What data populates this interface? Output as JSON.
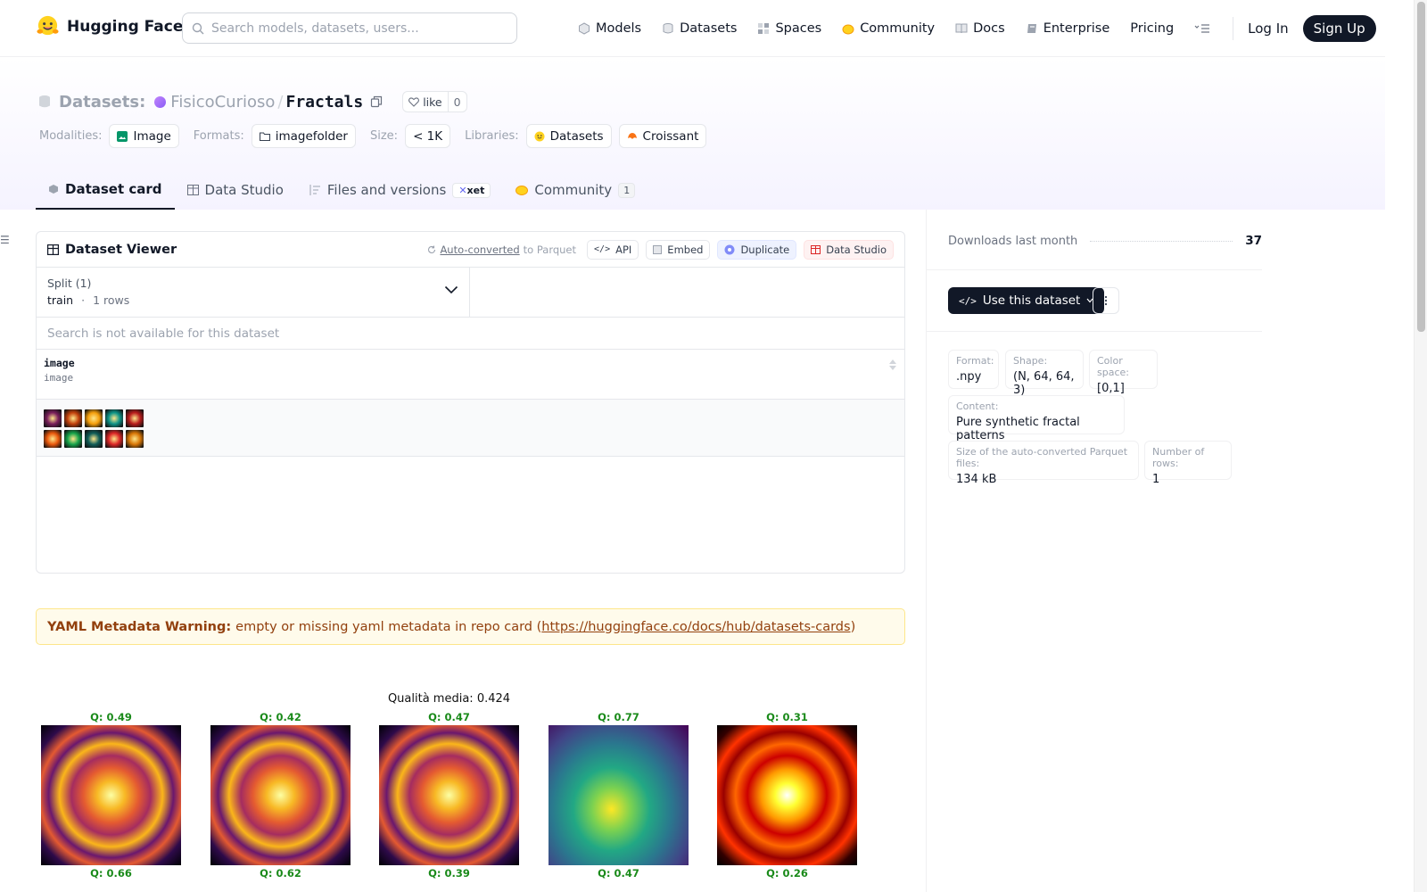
{
  "brand": {
    "name": "Hugging Face"
  },
  "search": {
    "placeholder": "Search models, datasets, users..."
  },
  "nav": {
    "items": [
      {
        "label": "Models",
        "icon": "models-icon"
      },
      {
        "label": "Datasets",
        "icon": "datasets-icon"
      },
      {
        "label": "Spaces",
        "icon": "spaces-icon"
      },
      {
        "label": "Community",
        "icon": "community-icon"
      },
      {
        "label": "Docs",
        "icon": "docs-icon"
      },
      {
        "label": "Enterprise",
        "icon": "enterprise-icon"
      },
      {
        "label": "Pricing"
      }
    ],
    "login": "Log In",
    "signup": "Sign Up"
  },
  "repo": {
    "type_label": "Datasets:",
    "org": "FisicoCurioso",
    "separator": "/",
    "name": "Fractals",
    "like_label": "like",
    "like_count": "0"
  },
  "tags": {
    "modalities_label": "Modalities:",
    "modality": "Image",
    "formats_label": "Formats:",
    "format": "imagefolder",
    "size_label": "Size:",
    "size": "< 1K",
    "libraries_label": "Libraries:",
    "libraries": [
      "Datasets",
      "Croissant"
    ]
  },
  "tabs": [
    {
      "label": "Dataset card",
      "active": true
    },
    {
      "label": "Data Studio"
    },
    {
      "label": "Files and versions",
      "badge": "xet"
    },
    {
      "label": "Community",
      "badge": "1"
    }
  ],
  "viewer": {
    "title": "Dataset Viewer",
    "auto_converted": "Auto-converted",
    "to_parquet": "to Parquet",
    "api": "API",
    "embed": "Embed",
    "duplicate": "Duplicate",
    "data_studio": "Data Studio",
    "split_label": "Split (1)",
    "split_name": "train",
    "split_dot": "·",
    "split_rows": "1 rows",
    "search_na": "Search is not available for this dataset",
    "column": {
      "name": "image",
      "type": "image"
    },
    "thumb_colors": [
      "#7a1f5c",
      "#c2410c",
      "#f59e0b",
      "#0d9488",
      "#b91c1c",
      "#ea580c",
      "#16a34a",
      "#115e59",
      "#dc2626",
      "#d97706"
    ]
  },
  "warning": {
    "title": "YAML Metadata Warning:",
    "text": "empty or missing yaml metadata in repo card (",
    "link": "https://huggingface.co/docs/hub/datasets-cards",
    "tail": ")"
  },
  "figure": {
    "title": "Qualità media: 0.424",
    "cells": [
      {
        "q": "Q: 0.49",
        "palette": "inferno"
      },
      {
        "q": "Q: 0.42",
        "palette": "inferno"
      },
      {
        "q": "Q: 0.47",
        "palette": "inferno"
      },
      {
        "q": "Q: 0.77",
        "palette": "viridis"
      },
      {
        "q": "Q: 0.31",
        "palette": "hot"
      }
    ],
    "next_row_q": [
      "Q: 0.66",
      "Q: 0.62",
      "Q: 0.39",
      "Q: 0.47",
      "Q: 0.26"
    ]
  },
  "sidebar": {
    "downloads_label": "Downloads last month",
    "downloads_value": "37",
    "use_button": "Use this dataset",
    "info": [
      {
        "k": "Format:",
        "v": ".npy"
      },
      {
        "k": "Shape:",
        "v": "(N, 64, 64, 3)"
      },
      {
        "k": "Color space:",
        "v": "[0,1]"
      },
      {
        "k": "Content:",
        "v": "Pure synthetic fractal patterns"
      },
      {
        "k": "Size of the auto-converted Parquet files:",
        "v": "134 kB"
      },
      {
        "k": "Number of rows:",
        "v": "1"
      }
    ]
  }
}
